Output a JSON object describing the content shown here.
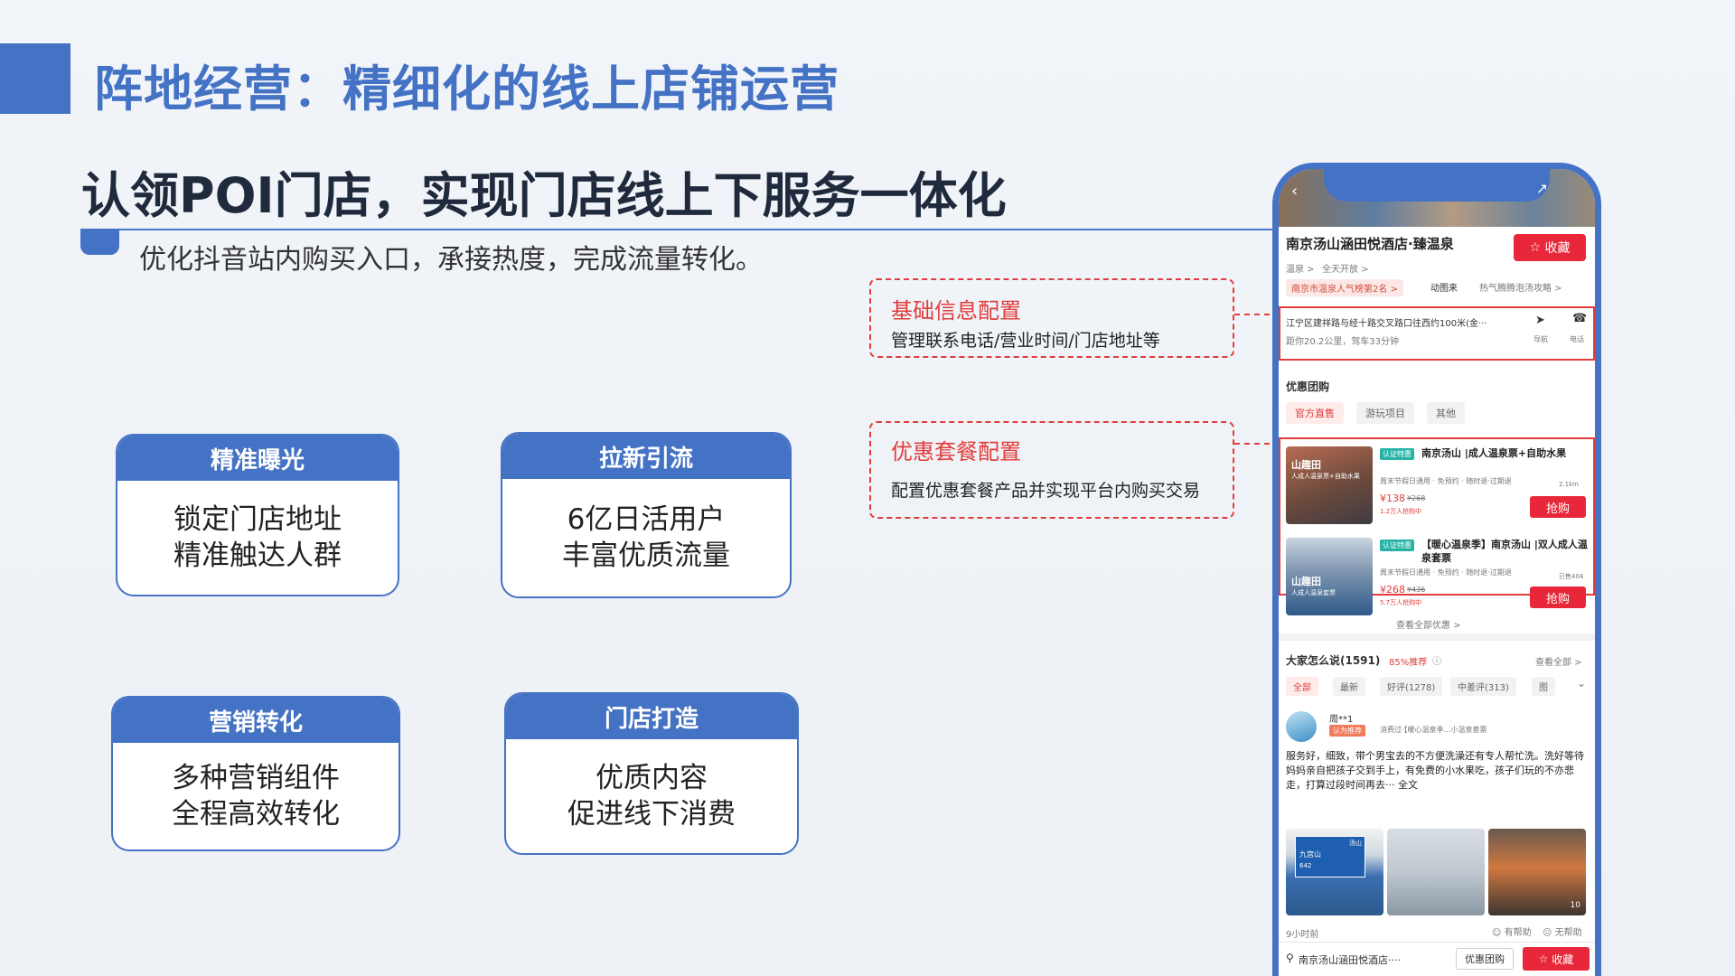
{
  "header": {
    "title": "阵地经营：精细化的线上店铺运营",
    "subtitle": "认领POI门店，实现门店线上下服务一体化",
    "tagline": "优化抖音站内购买入口，承接热度，完成流量转化。"
  },
  "features": [
    {
      "title": "精准曝光",
      "lines": [
        "锁定门店地址",
        "精准触达人群"
      ]
    },
    {
      "title": "拉新引流",
      "lines": [
        "6亿日活用户",
        "丰富优质流量"
      ]
    },
    {
      "title": "营销转化",
      "lines": [
        "多种营销组件",
        "全程高效转化"
      ]
    },
    {
      "title": "门店打造",
      "lines": [
        "优质内容",
        "促进线下消费"
      ]
    }
  ],
  "callouts": [
    {
      "title": "基础信息配置",
      "desc": "管理联系电话/营业时间/门店地址等"
    },
    {
      "title": "优惠套餐配置",
      "desc": "配置优惠套餐产品并实现平台内购买交易"
    }
  ],
  "phone": {
    "store_name": "南京汤山涵田悦酒店·臻温泉",
    "favorite": "收藏",
    "tags": [
      "温泉 >",
      "全天开放 >"
    ],
    "rank": "南京市温泉人气榜第2名 >",
    "badge": "动图来",
    "hot": "热气腾腾泡汤攻略 >",
    "address": "江宁区建祥路与经十路交叉路口往西约100米(金···",
    "distance": "距你20.2公里，驾车33分钟",
    "nav_label": "导航",
    "call_label": "电话",
    "deals_title": "优惠团购",
    "deal_tabs": [
      "官方直售",
      "游玩项目",
      "其他"
    ],
    "deals": [
      {
        "badge": "认证特惠",
        "name": "南京汤山 |成人温泉票+自助水果",
        "img_label": "山趣田",
        "img_sub": "人成人温泉票+自助水果",
        "meta": "周末节假日通用 · 免预约 · 随时退·过期退",
        "price": "¥138",
        "orig": "¥268",
        "sold": "1.2万人抢购中",
        "dist": "2.1km",
        "buy": "抢购"
      },
      {
        "badge": "认证特惠",
        "name": "【暖心温泉季】南京汤山 |双人成人温泉套票",
        "img_label": "山趣田",
        "img_sub": "人成人温泉套票",
        "meta": "周末节假日通用 · 免预约 · 随时退·过期退",
        "price": "¥268",
        "orig": "¥436",
        "sold": "5.7万人抢购中",
        "dist": "已售404",
        "buy": "抢购"
      }
    ],
    "see_all": "查看全部优惠 >",
    "reviews_title": "大家怎么说(1591)",
    "reviews_rate": "85%推荐",
    "reviews_all": "查看全部 >",
    "review_tabs": [
      "全部",
      "最新",
      "好评(1278)",
      "中差评(313)",
      "图"
    ],
    "reviewer": "周**1",
    "recommend": "认为推荐",
    "review_meta": "消费过·【暖心温泉季…小温泉套票",
    "review_text": "服务好，细致，带个男宝去的不方便洗澡还有专人帮忙洗。洗好等待妈妈亲自把孩子交到手上，有免费的小水果吃，孩子们玩的不亦悲走，打算过段时间再去··· 全文",
    "sign_top": "汤山",
    "sign_label": "九宫山",
    "sign_num": "642",
    "photo_count": "10",
    "time": "9小时前",
    "helpful": "有帮助",
    "unhelpful": "无帮助",
    "bottom_name": "南京汤山涵田悦酒店····",
    "bottom_deals": "优惠团购",
    "bottom_fav": "收藏"
  }
}
